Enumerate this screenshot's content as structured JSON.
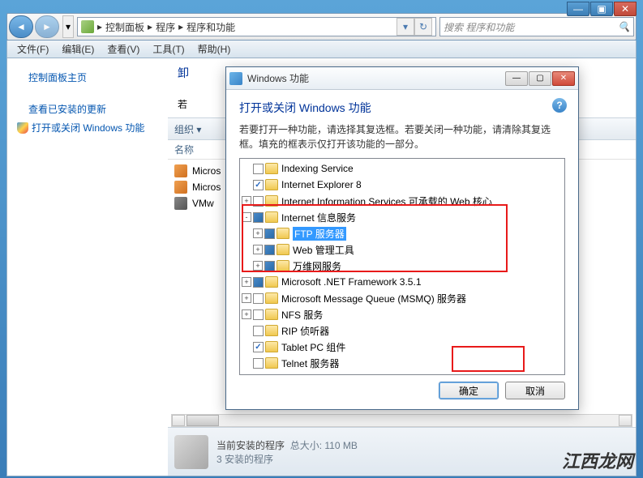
{
  "window_controls": {
    "min": "—",
    "max": "▣",
    "close": "✕"
  },
  "nav": {
    "back": "◄",
    "fwd": "►"
  },
  "breadcrumb": {
    "sep": "▸",
    "items": [
      "控制面板",
      "程序",
      "程序和功能"
    ]
  },
  "search": {
    "placeholder": "搜索 程序和功能",
    "icon": "🔍"
  },
  "menubar": [
    "文件(F)",
    "编辑(E)",
    "查看(V)",
    "工具(T)",
    "帮助(H)"
  ],
  "sidebar": {
    "links": [
      "控制面板主页",
      "查看已安装的更新",
      "打开或关闭 Windows 功能"
    ]
  },
  "content": {
    "heading_partial": "卸",
    "desc_partial": "若",
    "organize": "组织 ▾",
    "col_name": "名称",
    "programs": [
      "Micros",
      "Micros",
      "VMw"
    ],
    "summary_title": "当前安装的程序",
    "summary_size": "总大小: 110 MB",
    "summary_count": "3 安装的程序"
  },
  "dialog": {
    "title": "Windows 功能",
    "heading": "打开或关闭 Windows 功能",
    "desc": "若要打开一种功能，请选择其复选框。若要关闭一种功能，请清除其复选框。填充的框表示仅打开该功能的一部分。",
    "help": "?",
    "ok": "确定",
    "cancel": "取消",
    "tree": [
      {
        "level": 0,
        "exp": "",
        "chk": "empty",
        "label": "Indexing Service"
      },
      {
        "level": 0,
        "exp": "",
        "chk": "checked",
        "label": "Internet Explorer 8"
      },
      {
        "level": 0,
        "exp": "+",
        "chk": "empty",
        "label": "Internet Information Services 可承载的 Web 核心"
      },
      {
        "level": 0,
        "exp": "-",
        "chk": "partial",
        "label": "Internet 信息服务"
      },
      {
        "level": 1,
        "exp": "+",
        "chk": "partial",
        "label": "FTP 服务器",
        "selected": true
      },
      {
        "level": 1,
        "exp": "+",
        "chk": "partial",
        "label": "Web 管理工具"
      },
      {
        "level": 1,
        "exp": "+",
        "chk": "partial",
        "label": "万维网服务"
      },
      {
        "level": 0,
        "exp": "+",
        "chk": "partial",
        "label": "Microsoft .NET Framework 3.5.1"
      },
      {
        "level": 0,
        "exp": "+",
        "chk": "empty",
        "label": "Microsoft Message Queue (MSMQ) 服务器"
      },
      {
        "level": 0,
        "exp": "+",
        "chk": "empty",
        "label": "NFS 服务"
      },
      {
        "level": 0,
        "exp": "",
        "chk": "empty",
        "label": "RIP 侦听器"
      },
      {
        "level": 0,
        "exp": "",
        "chk": "checked",
        "label": "Tablet PC 组件"
      },
      {
        "level": 0,
        "exp": "",
        "chk": "empty",
        "label": "Telnet 服务器"
      }
    ]
  },
  "watermark": "江西龙网"
}
